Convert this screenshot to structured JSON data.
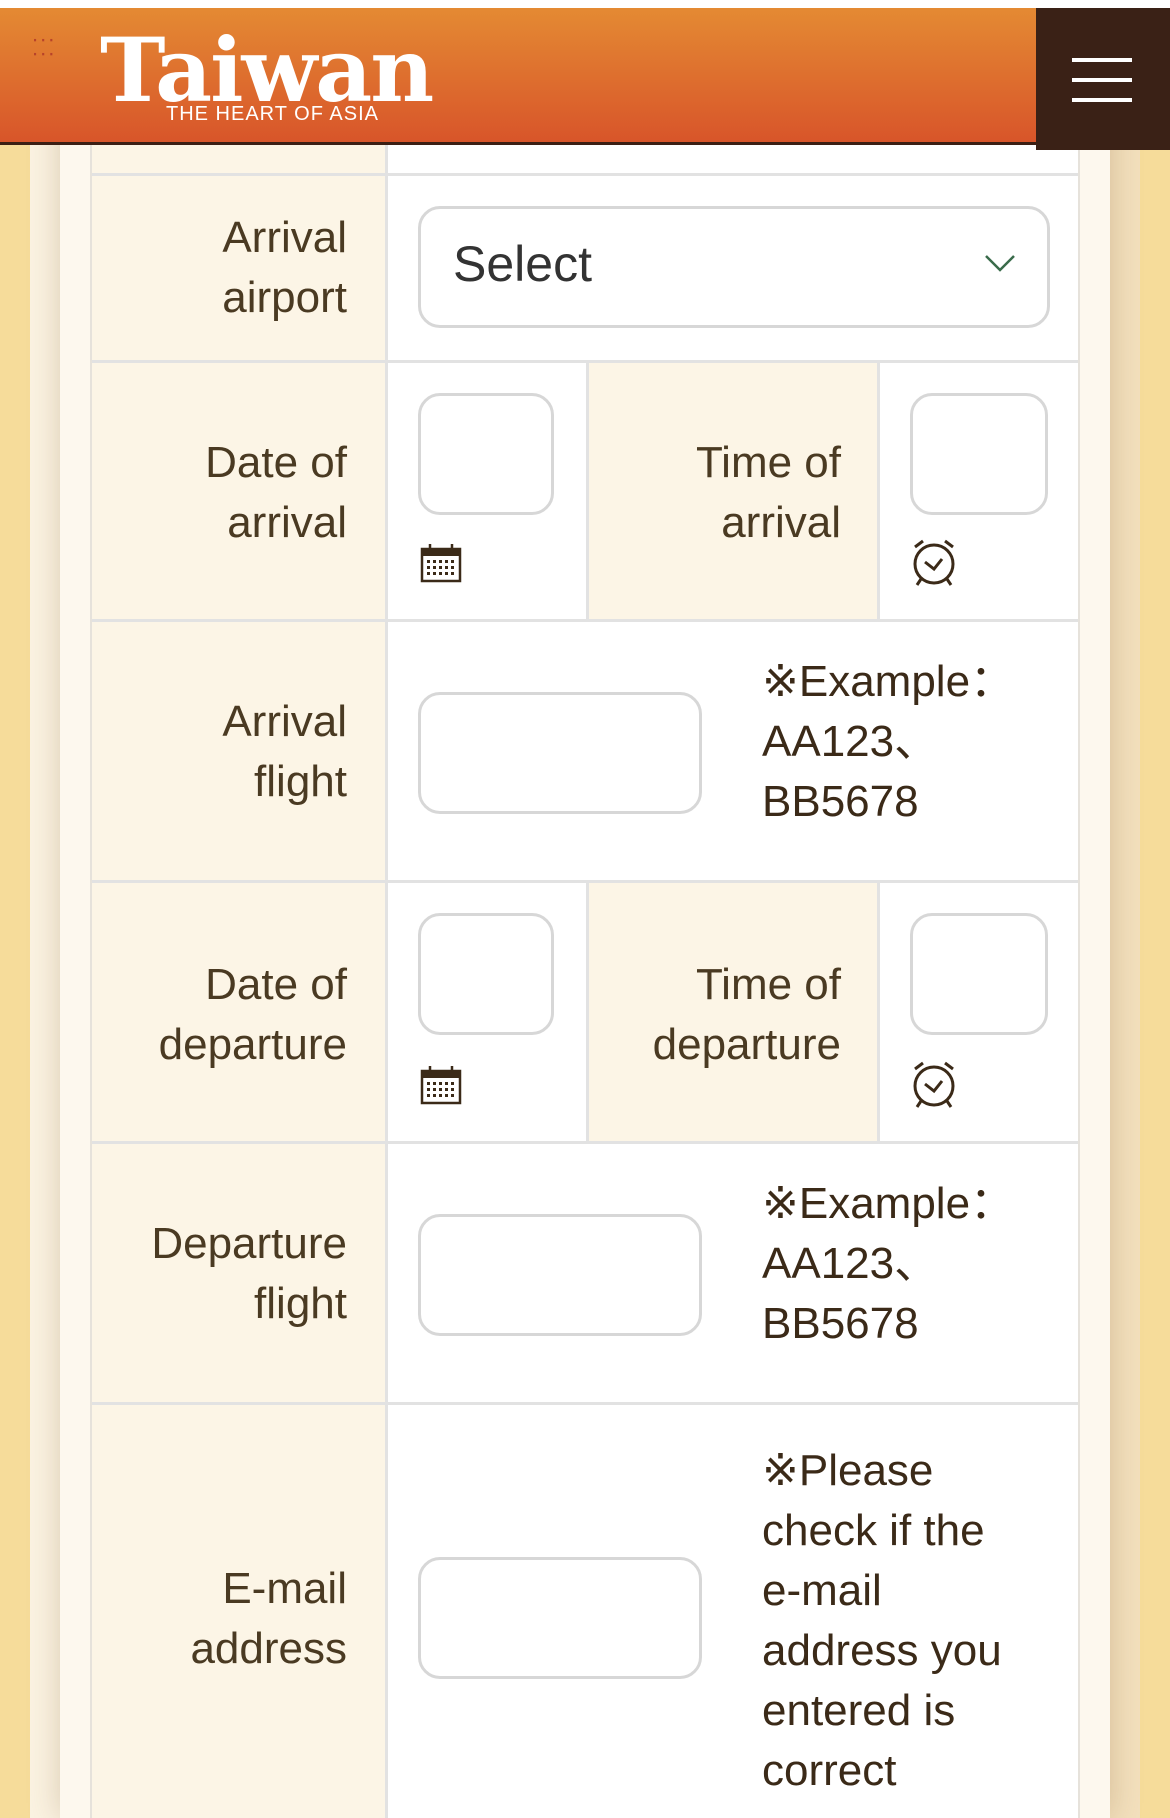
{
  "header": {
    "logo_title": "Taiwan",
    "logo_subtitle": "THE HEART OF ASIA",
    "dots": "· · ·\n· · ·"
  },
  "form": {
    "arrival_airport": {
      "label_line1": "Arrival",
      "label_line2": "airport",
      "select_value": "Select"
    },
    "date_of_arrival": {
      "label_line1": "Date of",
      "label_line2": "arrival",
      "value": ""
    },
    "time_of_arrival": {
      "label_line1": "Time of",
      "label_line2": "arrival",
      "value": ""
    },
    "arrival_flight": {
      "label_line1": "Arrival",
      "label_line2": "flight",
      "value": "",
      "note_line1": "※Example：",
      "note_line2": "AA123、",
      "note_line3": "BB5678"
    },
    "date_of_departure": {
      "label_line1": "Date of",
      "label_line2": "departure",
      "value": ""
    },
    "time_of_departure": {
      "label_line1": "Time of",
      "label_line2": "departure",
      "value": ""
    },
    "departure_flight": {
      "label_line1": "Departure",
      "label_line2": "flight",
      "value": "",
      "note_line1": "※Example：",
      "note_line2": "AA123、",
      "note_line3": "BB5678"
    },
    "email": {
      "label_line1": "E-mail",
      "label_line2": "address",
      "value": "",
      "note_lines": [
        "※Please",
        "check if the",
        "e-mail",
        "address you",
        "entered is",
        "correct"
      ]
    }
  },
  "colors": {
    "header_orange": "#e48a33",
    "header_red": "#d8552a",
    "menu_dark": "#3a2116",
    "label_bg": "#fcf5e6",
    "label_text": "#4a3a22"
  }
}
